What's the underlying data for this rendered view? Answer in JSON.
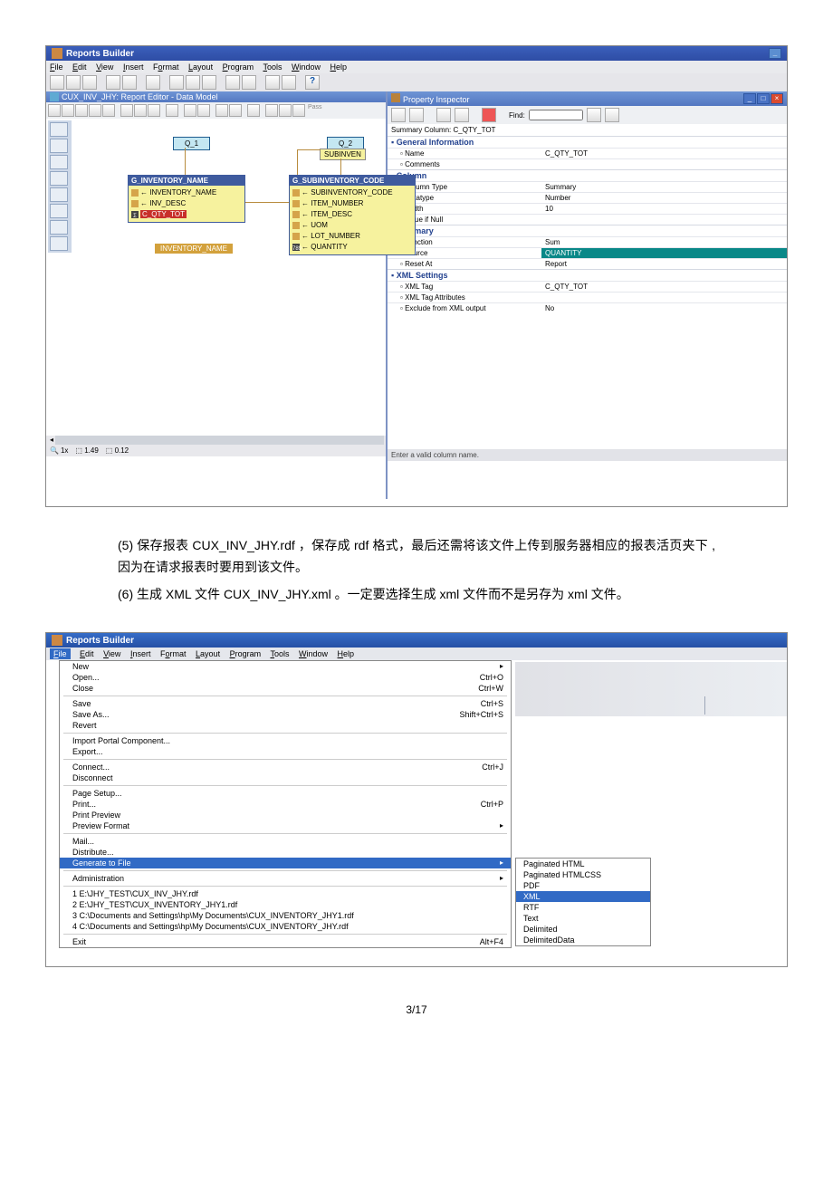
{
  "page_number": "3/17",
  "screenshot1": {
    "app_title": "Reports Builder",
    "menu": [
      "File",
      "Edit",
      "View",
      "Insert",
      "Format",
      "Layout",
      "Program",
      "Tools",
      "Window",
      "Help"
    ],
    "editor_title": "CUX_INV_JHY: Report Editor - Data Model",
    "q1_label": "Q_1",
    "q2_label": "Q_2",
    "subinven": "SUBINVEN",
    "group1": {
      "header": "G_INVENTORY_NAME",
      "items": [
        "INVENTORY_NAME",
        "INV_DESC"
      ],
      "sum": "C_QTY_TOT"
    },
    "group2": {
      "header": "G_SUBINVENTORY_CODE",
      "items": [
        "SUBINVENTORY_CODE",
        "ITEM_NUMBER",
        "ITEM_DESC",
        "UOM",
        "LOT_NUMBER",
        "QUANTITY"
      ]
    },
    "red_label": "INVENTORY_NAME",
    "status": {
      "zoom": "1x",
      "pos1": "1.49",
      "pos2": "0.12"
    }
  },
  "inspector": {
    "title": "Property Inspector",
    "find_label": "Find:",
    "header": "Summary Column: C_QTY_TOT",
    "sections": {
      "general": {
        "title": "General Information",
        "rows": [
          {
            "label": "Name",
            "value": "C_QTY_TOT"
          },
          {
            "label": "Comments",
            "value": ""
          }
        ]
      },
      "column": {
        "title": "Column",
        "rows": [
          {
            "label": "Column Type",
            "value": "Summary"
          },
          {
            "label": "Datatype",
            "value": "Number"
          },
          {
            "label": "Width",
            "value": "10"
          },
          {
            "label": "Value if Null",
            "value": ""
          }
        ]
      },
      "summary": {
        "title": "Summary",
        "rows": [
          {
            "label": "Function",
            "value": "Sum"
          },
          {
            "label": "Source",
            "value": "QUANTITY",
            "highlight": true
          },
          {
            "label": "Reset At",
            "value": "Report"
          }
        ]
      },
      "xml": {
        "title": "XML Settings",
        "rows": [
          {
            "label": "XML Tag",
            "value": "C_QTY_TOT"
          },
          {
            "label": "XML Tag Attributes",
            "value": ""
          },
          {
            "label": "Exclude from XML output",
            "value": "No"
          }
        ]
      }
    },
    "bottom_hint": "Enter a valid column name."
  },
  "body": {
    "item5_num": "(5)",
    "item5": "保存报表 CUX_INV_JHY.rdf ，保存成 rdf 格式，最后还需将该文件上传到服务器相应的报表活页夹下 ,因为在请求报表时要用到该文件。",
    "item6_num": "(6)",
    "item6": "生成 XML 文件 CUX_INV_JHY.xml 。一定要选择生成 xml 文件而不是另存为 xml 文件。"
  },
  "screenshot2": {
    "app_title": "Reports Builder",
    "menu": [
      "File",
      "Edit",
      "View",
      "Insert",
      "Format",
      "Layout",
      "Program",
      "Tools",
      "Window",
      "Help"
    ],
    "file_menu": [
      {
        "label": "New",
        "shortcut": "",
        "arrow": true
      },
      {
        "label": "Open...",
        "shortcut": "Ctrl+O"
      },
      {
        "label": "Close",
        "shortcut": "Ctrl+W"
      },
      {
        "sep": true
      },
      {
        "label": "Save",
        "shortcut": "Ctrl+S"
      },
      {
        "label": "Save As...",
        "shortcut": "Shift+Ctrl+S"
      },
      {
        "label": "Revert",
        "shortcut": ""
      },
      {
        "sep": true
      },
      {
        "label": "Import Portal Component...",
        "shortcut": ""
      },
      {
        "label": "Export...",
        "shortcut": ""
      },
      {
        "sep": true
      },
      {
        "label": "Connect...",
        "shortcut": "Ctrl+J"
      },
      {
        "label": "Disconnect",
        "shortcut": ""
      },
      {
        "sep": true
      },
      {
        "label": "Page Setup...",
        "shortcut": ""
      },
      {
        "label": "Print...",
        "shortcut": "Ctrl+P"
      },
      {
        "label": "Print Preview",
        "shortcut": ""
      },
      {
        "label": "Preview Format",
        "shortcut": "",
        "arrow": true
      },
      {
        "sep": true
      },
      {
        "label": "Mail...",
        "shortcut": ""
      },
      {
        "label": "Distribute...",
        "shortcut": ""
      },
      {
        "label": "Generate to File",
        "shortcut": "",
        "arrow": true,
        "highlight": true
      },
      {
        "sep": true
      },
      {
        "label": "Administration",
        "shortcut": "",
        "arrow": true
      },
      {
        "sep": true
      },
      {
        "label": "1 E:\\JHY_TEST\\CUX_INV_JHY.rdf",
        "shortcut": ""
      },
      {
        "label": "2 E:\\JHY_TEST\\CUX_INVENTORY_JHY1.rdf",
        "shortcut": ""
      },
      {
        "label": "3 C:\\Documents and Settings\\hp\\My Documents\\CUX_INVENTORY_JHY1.rdf",
        "shortcut": ""
      },
      {
        "label": "4 C:\\Documents and Settings\\hp\\My Documents\\CUX_INVENTORY_JHY.rdf",
        "shortcut": ""
      },
      {
        "sep": true
      },
      {
        "label": "Exit",
        "shortcut": "Alt+F4"
      }
    ],
    "submenu": [
      {
        "label": "Paginated HTML"
      },
      {
        "label": "Paginated HTMLCSS"
      },
      {
        "label": "PDF"
      },
      {
        "label": "XML",
        "highlight": true
      },
      {
        "label": "RTF"
      },
      {
        "label": "Text"
      },
      {
        "label": "Delimited"
      },
      {
        "label": "DelimitedData"
      }
    ]
  }
}
